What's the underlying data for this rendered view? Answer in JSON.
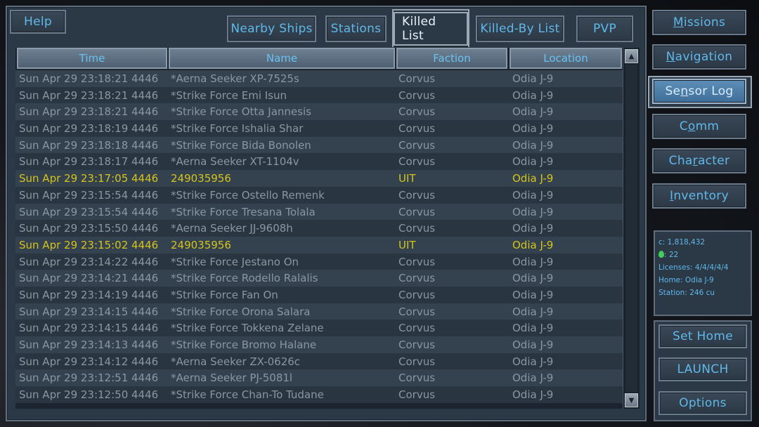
{
  "header": {
    "help_label": "Help",
    "tabs": [
      {
        "label": "Nearby Ships",
        "active": false
      },
      {
        "label": "Stations",
        "active": false
      },
      {
        "label": "Killed List",
        "active": true
      },
      {
        "label": "Killed-By List",
        "active": false
      },
      {
        "label": "PVP",
        "active": false
      }
    ]
  },
  "table": {
    "columns": [
      "Time",
      "Name",
      "Faction",
      "Location"
    ],
    "rows": [
      {
        "time": "Sun Apr 29 23:18:21 4446",
        "name": "*Aerna Seeker XP-7525s",
        "faction": "Corvus",
        "location": "Odia J-9",
        "highlight": false
      },
      {
        "time": "Sun Apr 29 23:18:21 4446",
        "name": "*Strike Force Emi Isun",
        "faction": "Corvus",
        "location": "Odia J-9",
        "highlight": false
      },
      {
        "time": "Sun Apr 29 23:18:21 4446",
        "name": "*Strike Force Otta Jannesis",
        "faction": "Corvus",
        "location": "Odia J-9",
        "highlight": false
      },
      {
        "time": "Sun Apr 29 23:18:19 4446",
        "name": "*Strike Force Ishalia Shar",
        "faction": "Corvus",
        "location": "Odia J-9",
        "highlight": false
      },
      {
        "time": "Sun Apr 29 23:18:18 4446",
        "name": "*Strike Force Bida Bonolen",
        "faction": "Corvus",
        "location": "Odia J-9",
        "highlight": false
      },
      {
        "time": "Sun Apr 29 23:18:17 4446",
        "name": "*Aerna Seeker XT-1104v",
        "faction": "Corvus",
        "location": "Odia J-9",
        "highlight": false
      },
      {
        "time": "Sun Apr 29 23:17:05 4446",
        "name": "249035956",
        "faction": "UIT",
        "location": "Odia J-9",
        "highlight": true
      },
      {
        "time": "Sun Apr 29 23:15:54 4446",
        "name": "*Strike Force Ostello Remenk",
        "faction": "Corvus",
        "location": "Odia J-9",
        "highlight": false
      },
      {
        "time": "Sun Apr 29 23:15:54 4446",
        "name": "*Strike Force Tresana Tolala",
        "faction": "Corvus",
        "location": "Odia J-9",
        "highlight": false
      },
      {
        "time": "Sun Apr 29 23:15:50 4446",
        "name": "*Aerna Seeker JJ-9608h",
        "faction": "Corvus",
        "location": "Odia J-9",
        "highlight": false
      },
      {
        "time": "Sun Apr 29 23:15:02 4446",
        "name": "249035956",
        "faction": "UIT",
        "location": "Odia J-9",
        "highlight": true
      },
      {
        "time": "Sun Apr 29 23:14:22 4446",
        "name": "*Strike Force Jestano On",
        "faction": "Corvus",
        "location": "Odia J-9",
        "highlight": false
      },
      {
        "time": "Sun Apr 29 23:14:21 4446",
        "name": "*Strike Force Rodello Ralalis",
        "faction": "Corvus",
        "location": "Odia J-9",
        "highlight": false
      },
      {
        "time": "Sun Apr 29 23:14:19 4446",
        "name": "*Strike Force Fan On",
        "faction": "Corvus",
        "location": "Odia J-9",
        "highlight": false
      },
      {
        "time": "Sun Apr 29 23:14:15 4446",
        "name": "*Strike Force Orona Salara",
        "faction": "Corvus",
        "location": "Odia J-9",
        "highlight": false
      },
      {
        "time": "Sun Apr 29 23:14:15 4446",
        "name": "*Strike Force Tokkena Zelane",
        "faction": "Corvus",
        "location": "Odia J-9",
        "highlight": false
      },
      {
        "time": "Sun Apr 29 23:14:13 4446",
        "name": "*Strike Force Bromo Halane",
        "faction": "Corvus",
        "location": "Odia J-9",
        "highlight": false
      },
      {
        "time": "Sun Apr 29 23:14:12 4446",
        "name": "*Aerna Seeker ZX-0626c",
        "faction": "Corvus",
        "location": "Odia J-9",
        "highlight": false
      },
      {
        "time": "Sun Apr 29 23:12:51 4446",
        "name": "*Aerna Seeker PJ-5081l",
        "faction": "Corvus",
        "location": "Odia J-9",
        "highlight": false
      },
      {
        "time": "Sun Apr 29 23:12:50 4446",
        "name": "*Strike Force Chan-To Tudane",
        "faction": "Corvus",
        "location": "Odia J-9",
        "highlight": false
      }
    ]
  },
  "scrollbar": {
    "up_glyph": "▲",
    "down_glyph": "▼"
  },
  "menu": [
    {
      "pre": "",
      "u": "M",
      "post": "issions",
      "active": false
    },
    {
      "pre": "",
      "u": "N",
      "post": "avigation",
      "active": false
    },
    {
      "pre": "Se",
      "u": "n",
      "post": "sor Log",
      "active": true
    },
    {
      "pre": "C",
      "u": "o",
      "post": "mm",
      "active": false
    },
    {
      "pre": "Cha",
      "u": "r",
      "post": "acter",
      "active": false
    },
    {
      "pre": "",
      "u": "I",
      "post": "nventory",
      "active": false
    }
  ],
  "stats": {
    "credits": "c: 1,818,432",
    "gems": ": 22",
    "licenses": "Licenses: 4/4/4/4/4",
    "home": "Home: Odia J-9",
    "station": "Station: 246 cu"
  },
  "actions": {
    "set_home": "Set Home",
    "launch": "LAUNCH",
    "options": "Options"
  },
  "colors": {
    "accent_text": "#5fb8ea",
    "highlight_row": "#d4c41c",
    "row_text": "#8a96a2",
    "panel_bg": "#2b3846",
    "active_button": "#4f7fa8"
  }
}
